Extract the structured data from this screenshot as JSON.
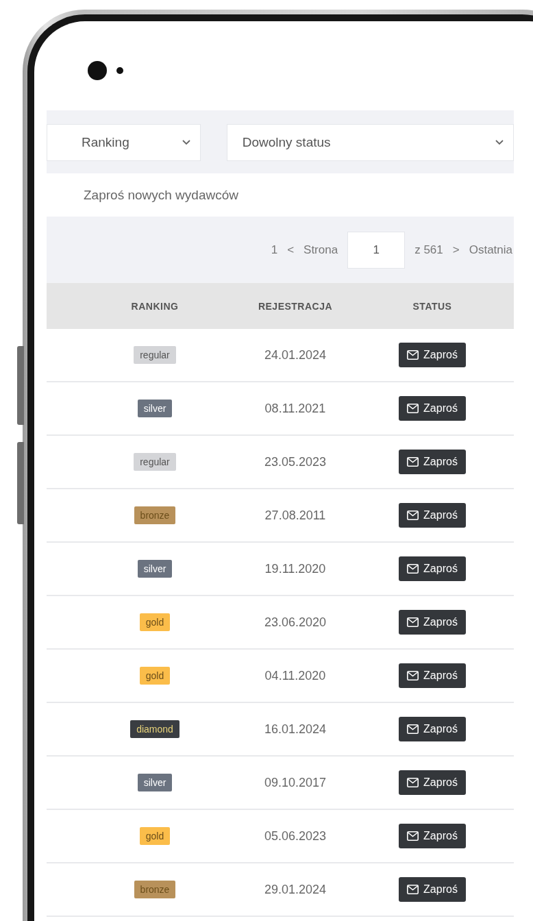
{
  "filters": [
    {
      "value": "Ranking"
    },
    {
      "value": "Dowolny status"
    }
  ],
  "invite_link": "Zaproś nowych wydawców",
  "pagination": {
    "first": "1",
    "prev": "<",
    "page_label": "Strona",
    "page": "1",
    "total": "z 561",
    "next": ">",
    "last": "Ostatnia"
  },
  "table": {
    "columns": [
      "RANKING",
      "REJESTRACJA",
      "STATUS"
    ],
    "rows": [
      {
        "ranking": "regular",
        "color": "#d4d5d8",
        "registered": "24.01.2024",
        "action": "Zaproś"
      },
      {
        "ranking": "silver",
        "color": "#6b7380",
        "registered": "08.11.2021",
        "action": "Zaproś"
      },
      {
        "ranking": "regular",
        "color": "#d4d5d8",
        "registered": "23.05.2023",
        "action": "Zaproś"
      },
      {
        "ranking": "bronze",
        "color": "#b8915a",
        "registered": "27.08.2011",
        "action": "Zaproś"
      },
      {
        "ranking": "silver",
        "color": "#6b7380",
        "registered": "19.11.2020",
        "action": "Zaproś"
      },
      {
        "ranking": "gold",
        "color": "#fbbd4a",
        "registered": "23.06.2020",
        "action": "Zaproś"
      },
      {
        "ranking": "gold",
        "color": "#fbbd4a",
        "registered": "04.11.2020",
        "action": "Zaproś"
      },
      {
        "ranking": "diamond",
        "color": "#3a3d42",
        "registered": "16.01.2024",
        "action": "Zaproś"
      },
      {
        "ranking": "silver",
        "color": "#6b7380",
        "registered": "09.10.2017",
        "action": "Zaproś"
      },
      {
        "ranking": "gold",
        "color": "#fbbd4a",
        "registered": "05.06.2023",
        "action": "Zaproś"
      },
      {
        "ranking": "bronze",
        "color": "#b8915a",
        "registered": "29.01.2024",
        "action": "Zaproś"
      }
    ]
  }
}
